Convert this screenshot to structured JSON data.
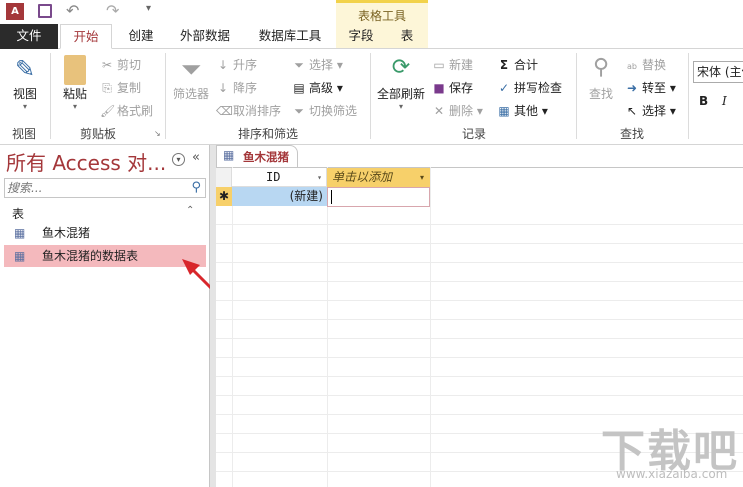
{
  "titlebar": {
    "context_group": "表格工具"
  },
  "tabs": [
    "文件",
    "开始",
    "创建",
    "外部数据",
    "数据库工具",
    "字段",
    "表"
  ],
  "ribbon": {
    "view": {
      "button": "视图",
      "group": "视图"
    },
    "clipboard": {
      "paste": "粘贴",
      "cut": "剪切",
      "copy": "复制",
      "format_painter": "格式刷",
      "group": "剪贴板"
    },
    "sort_filter": {
      "filter": "筛选器",
      "ascending": "升序",
      "descending": "降序",
      "remove_sort": "取消排序",
      "selection": "选择",
      "advanced": "高级",
      "toggle_filter": "切换筛选",
      "group": "排序和筛选"
    },
    "records": {
      "refresh_all": "全部刷新",
      "new": "新建",
      "save": "保存",
      "delete": "删除",
      "totals": "合计",
      "spelling": "拼写检查",
      "more": "其他",
      "group": "记录"
    },
    "find": {
      "find": "查找",
      "replace": "替换",
      "goto": "转至",
      "select": "选择",
      "group": "查找"
    },
    "font": {
      "font_name": "宋体 (主体)",
      "bold": "B",
      "italic": "I"
    }
  },
  "nav": {
    "title": "所有 Access 对...",
    "search_placeholder": "搜索...",
    "section": "表",
    "items": [
      "鱼木混猪",
      "鱼木混猪的数据表"
    ],
    "selected_index": 1
  },
  "document": {
    "tab": "鱼木混猪",
    "columns": [
      "ID",
      "单击以添加"
    ],
    "new_row_marker": "✱",
    "new_row_id": "(新建)"
  },
  "watermark": {
    "text": "下载吧",
    "url": "www.xiazaiba.com"
  }
}
